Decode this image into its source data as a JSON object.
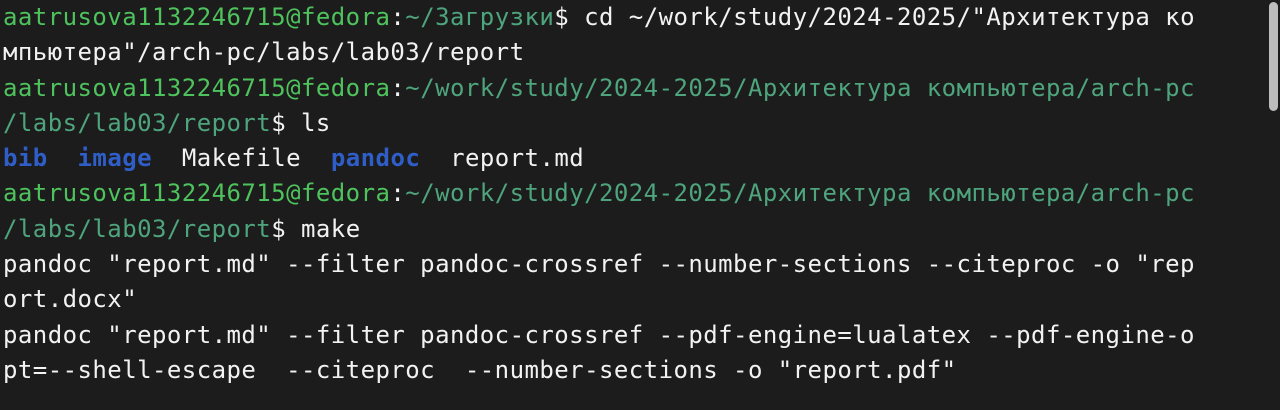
{
  "terminal": {
    "lines": [
      {
        "type": "prompt",
        "user": "aatrusova1132246715@fedora",
        "sep": ":",
        "path": "~/Загрузки",
        "dollar": "$",
        "cmd": " cd ~/work/study/2024-2025/\"Архитектура ко"
      },
      {
        "type": "plain",
        "text": "мпьютера\"/arch-pc/labs/lab03/report"
      },
      {
        "type": "prompt",
        "user": "aatrusova1132246715@fedora",
        "sep": ":",
        "path": "~/work/study/2024-2025/Архитектура компьютера/arch-pc",
        "dollar": "",
        "cmd": ""
      },
      {
        "type": "pathcont",
        "path": "/labs/lab03/report",
        "dollar": "$",
        "cmd": " ls"
      },
      {
        "type": "ls",
        "items": [
          {
            "name": "bib",
            "kind": "dir"
          },
          {
            "name": "  ",
            "kind": "space"
          },
          {
            "name": "image",
            "kind": "dir"
          },
          {
            "name": "  ",
            "kind": "space"
          },
          {
            "name": "Makefile",
            "kind": "file"
          },
          {
            "name": "  ",
            "kind": "space"
          },
          {
            "name": "pandoc",
            "kind": "dir"
          },
          {
            "name": "  ",
            "kind": "space"
          },
          {
            "name": "report.md",
            "kind": "file"
          }
        ]
      },
      {
        "type": "prompt",
        "user": "aatrusova1132246715@fedora",
        "sep": ":",
        "path": "~/work/study/2024-2025/Архитектура компьютера/arch-pc",
        "dollar": "",
        "cmd": ""
      },
      {
        "type": "pathcont",
        "path": "/labs/lab03/report",
        "dollar": "$",
        "cmd": " make"
      },
      {
        "type": "plain",
        "text": "pandoc \"report.md\" --filter pandoc-crossref --number-sections --citeproc -o \"rep"
      },
      {
        "type": "plain",
        "text": "ort.docx\""
      },
      {
        "type": "plain",
        "text": "pandoc \"report.md\" --filter pandoc-crossref --pdf-engine=lualatex --pdf-engine-o"
      },
      {
        "type": "plain",
        "text": "pt=--shell-escape  --citeproc  --number-sections -o \"report.pdf\""
      }
    ]
  },
  "colors": {
    "background": "#1c1c1c",
    "user": "#4ec35d",
    "path": "#4ea47c",
    "text": "#f2f2f2",
    "directory": "#2f5ec8",
    "scrollbar_thumb": "#bdbdbd"
  }
}
